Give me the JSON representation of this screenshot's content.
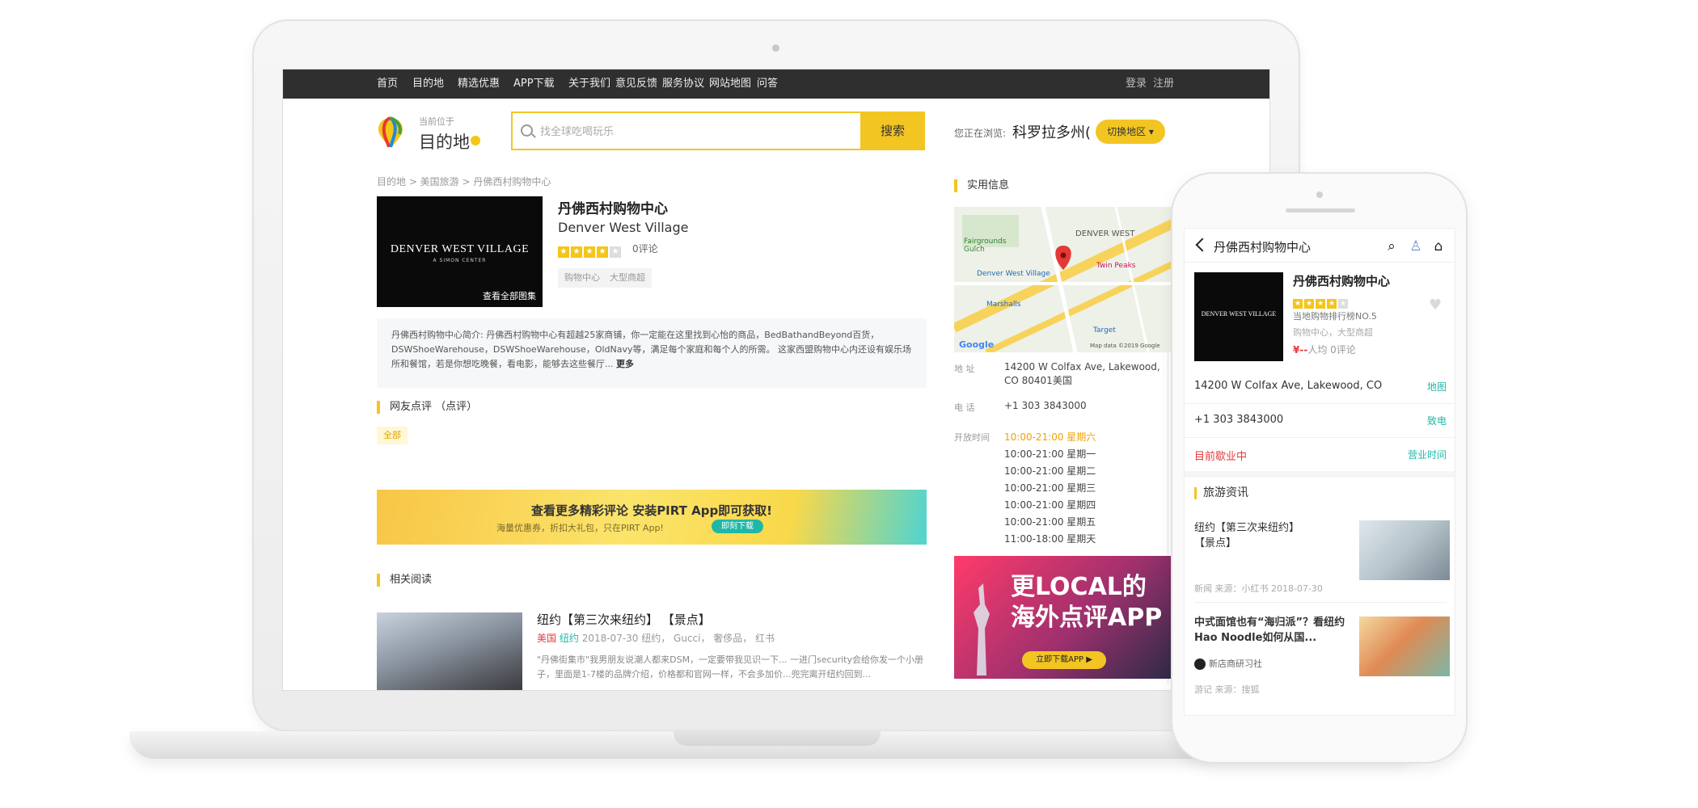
{
  "nav": {
    "items": [
      "首页",
      "目的地",
      "精选优惠",
      "APP下载",
      "关于我们",
      "意见反馈",
      "服务协议",
      "网站地图",
      "问答"
    ],
    "login": "登录",
    "register": "注册"
  },
  "header": {
    "location_small": "当前位于",
    "location_big": "目的地",
    "search_placeholder": "找全球吃喝玩乐",
    "search_button": "搜索",
    "browsing_label": "您正在浏览:",
    "browsing_city": "科罗拉多州(",
    "switch_region": "切换地区"
  },
  "breadcrumb": "目的地 > 美国旅游 > 丹佛西村购物中心",
  "store": {
    "name": "丹佛西村购物中心",
    "name_en": "Denver West Village",
    "rating": 4,
    "rating_max": 5,
    "review_count": "0评论",
    "tags": [
      "购物中心",
      "大型商超"
    ],
    "image_brand": "DENVER WEST VILLAGE",
    "image_brand_sub": "A SIMON CENTER",
    "gallery_link": "查看全部图集",
    "intro": "丹佛西村购物中心简介: 丹佛西村购物中心有超越25家商铺，你一定能在这里找到心怡的商品，BedBathandBeyond百货，DSWShoeWarehouse，DSWShoeWarehouse，OldNavy等，满足每个家庭和每个人的所需。 这家西盟购物中心内还设有娱乐场所和餐馆，若是你想吃晚餐，看电影，能够去这些餐厅...",
    "intro_more": "更多"
  },
  "reviews": {
    "heading": "网友点评 （点评）",
    "filter_all": "全部"
  },
  "banner": {
    "title": "查看更多精彩评论 安装PIRT App即可获取!",
    "subtitle": "海量优惠券，折扣大礼包，只在PIRT App!",
    "download": "即刻下载"
  },
  "related": {
    "heading": "相关阅读",
    "article": {
      "title": "纽约【第三次来纽约】 【景点】",
      "meta_country": "美国",
      "meta_city": "纽约",
      "meta_rest": "2018-07-30    纽约，  Gucci，  奢侈品，  红书",
      "excerpt": "\"丹佛街集市\"我男朋友说潮人都来DSM，一定要带我见识一下... 一进门security会给你发一个小册子，里面是1-7楼的品牌介绍，价格都和官网一样，不会多加价...兜完离开纽约回到..."
    }
  },
  "side": {
    "heading": "实用信息",
    "map_labels": [
      "DENVER WEST",
      "Fairgrounds Gulch",
      "Denver West Village",
      "Twin Peaks",
      "Marshalls",
      "Target",
      "Map data ©2019 Google",
      "Google"
    ],
    "address_label": "地  址",
    "address": "14200 W Colfax Ave, Lakewood, CO 80401美国",
    "phone_label": "电  话",
    "phone": "+1 303 3843000",
    "hours_label": "开放时间",
    "hours": [
      "10:00-21:00 星期六",
      "10:00-21:00 星期一",
      "10:00-21:00 星期二",
      "10:00-21:00 星期三",
      "10:00-21:00 星期四",
      "10:00-21:00 星期五",
      "11:00-18:00 星期天"
    ],
    "ad_title": "更LOCAL的海外点评APP",
    "ad_button": "立即下载APP ▶"
  },
  "phone": {
    "title": "丹佛西村购物中心",
    "store_name": "丹佛西村购物中心",
    "rating": 4,
    "rank": "当地购物排行榜NO.5",
    "categories": "购物中心，大型商超",
    "price_symbol": "¥--",
    "price_rest": "人均 0评论",
    "image_brand": "DENVER WEST VILLAGE",
    "address": "14200 W Colfax Ave, Lakewood, CO",
    "address_action": "地图",
    "phone": "+1 303 3843000",
    "phone_action": "致电",
    "status": "目前歇业中",
    "status_action": "营业时间",
    "news_heading": "旅游资讯",
    "news1_title": "纽约【第三次来纽约】 【景点】",
    "news1_meta": "新闻  来源：小红书  2018-07-30",
    "news2_title": "中式面馆也有“海归派”？看纽约Hao Noodle如何从国...",
    "news2_source": "新店商研习社",
    "news2_meta": "游记  来源：搜狐"
  },
  "colors": {
    "accent": "#f3c523",
    "teal": "#1fb8a7",
    "nav_bg": "#2f2f2f",
    "price_red": "#e4393c"
  }
}
